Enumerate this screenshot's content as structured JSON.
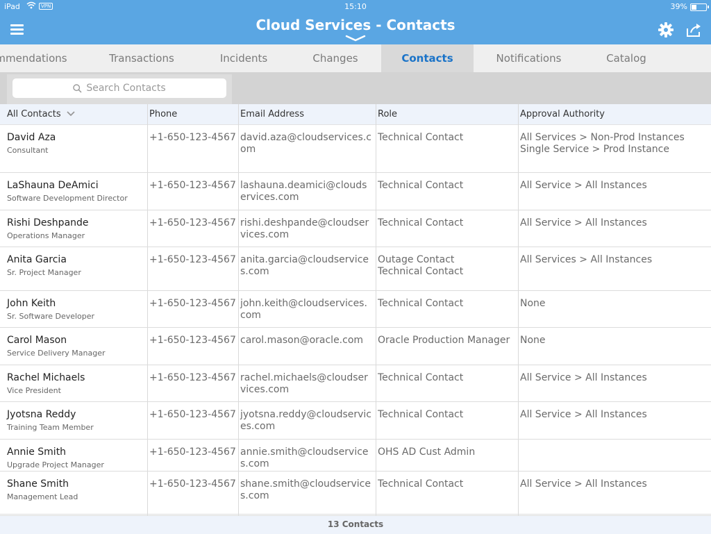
{
  "status_bar": {
    "device": "iPad",
    "vpn": "VPN",
    "time": "15:10",
    "battery_percent": "39%",
    "battery_level": 0.39
  },
  "header": {
    "title": "Cloud Services - Contacts",
    "icons": [
      "menu-icon",
      "chevron-down-icon",
      "gear-icon",
      "share-icon"
    ]
  },
  "tabs": [
    {
      "label": "mmendations"
    },
    {
      "label": "Transactions"
    },
    {
      "label": "Incidents"
    },
    {
      "label": "Changes"
    },
    {
      "label": "Contacts",
      "active": true
    },
    {
      "label": "Notifications"
    },
    {
      "label": "Catalog"
    }
  ],
  "search": {
    "placeholder": "Search Contacts"
  },
  "table": {
    "headers": {
      "contacts": "All Contacts",
      "phone": "Phone",
      "email": "Email Address",
      "role": "Role",
      "approval": "Approval Authority"
    },
    "rows": [
      {
        "name": "David Aza",
        "title": "Consultant",
        "phone": "+1-650-123-4567",
        "email": "david.aza@cloudservices.com",
        "role": [
          "Technical Contact"
        ],
        "approval": [
          "All Services > Non-Prod Instances",
          "Single Service > Prod Instance"
        ]
      },
      {
        "name": "LaShauna DeAmici",
        "title": "Software Development Director",
        "phone": "+1-650-123-4567",
        "email": "lashauna.deamici@cloudservices.com",
        "role": [
          "Technical Contact"
        ],
        "approval": [
          "All Service > All Instances"
        ]
      },
      {
        "name": "Rishi Deshpande",
        "title": "Operations Manager",
        "phone": "+1-650-123-4567",
        "email": "rishi.deshpande@cloudservices.com",
        "role": [
          "Technical Contact"
        ],
        "approval": [
          "All Service > All Instances"
        ]
      },
      {
        "name": "Anita Garcia",
        "title": "Sr. Project Manager",
        "phone": "+1-650-123-4567",
        "email": "anita.garcia@cloudservices.com",
        "role": [
          "Outage Contact",
          "Technical Contact"
        ],
        "approval": [
          "All Services > All Instances"
        ]
      },
      {
        "name": "John Keith",
        "title": "Sr. Software Developer",
        "phone": "+1-650-123-4567",
        "email": "john.keith@cloudservices.com",
        "role": [
          "Technical Contact"
        ],
        "approval": [
          "None"
        ]
      },
      {
        "name": "Carol Mason",
        "title": "Service Delivery Manager",
        "phone": "+1-650-123-4567",
        "email": "carol.mason@oracle.com",
        "role": [
          "Oracle Production Manager"
        ],
        "approval": [
          "None"
        ]
      },
      {
        "name": "Rachel Michaels",
        "title": "Vice President",
        "phone": "+1-650-123-4567",
        "email": "rachel.michaels@cloudservices.com",
        "role": [
          "Technical Contact"
        ],
        "approval": [
          "All Service > All Instances"
        ]
      },
      {
        "name": "Jyotsna Reddy",
        "title": "Training Team Member",
        "phone": "+1-650-123-4567",
        "email": "jyotsna.reddy@cloudservices.com",
        "role": [
          "Technical Contact"
        ],
        "approval": [
          "All Service > All Instances"
        ]
      },
      {
        "name": "Annie Smith",
        "title": "Upgrade Project Manager",
        "phone": "+1-650-123-4567",
        "email": "annie.smith@cloudservices.com",
        "role": [
          "OHS AD Cust Admin"
        ],
        "approval": []
      },
      {
        "name": "Shane Smith",
        "title": "Management Lead",
        "phone": "+1-650-123-4567",
        "email": "shane.smith@cloudservices.com",
        "role": [
          "Technical Contact"
        ],
        "approval": [
          "All Service > All Instances"
        ]
      }
    ]
  },
  "footer": {
    "count_label": "13 Contacts"
  },
  "colors": {
    "header_bg": "#5aa6e3",
    "accent": "#1a73c8",
    "tab_bg": "#efefef",
    "tab_active_bg": "#d9d9d9",
    "table_header_bg": "#eef3fb"
  }
}
